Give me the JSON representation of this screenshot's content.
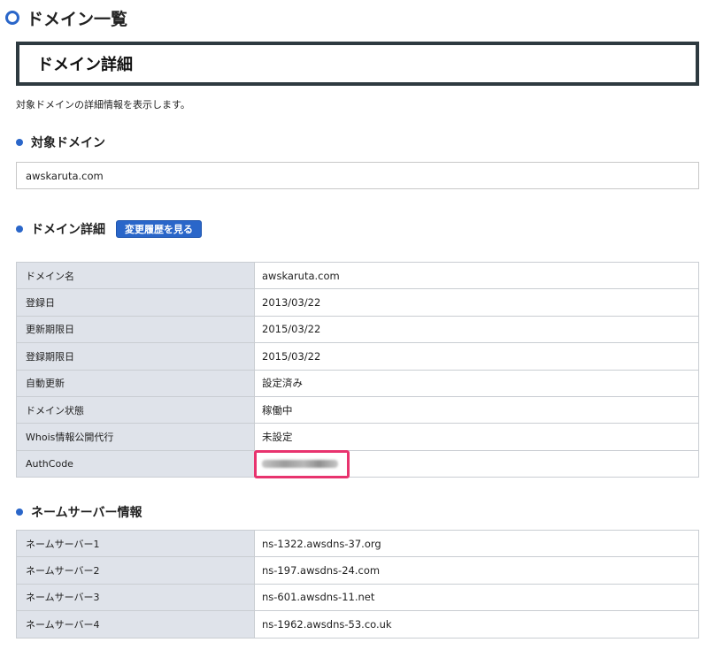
{
  "page_title": "ドメイン一覧",
  "header_box_title": "ドメイン詳細",
  "description": "対象ドメインの詳細情報を表示します。",
  "target_section": {
    "title": "対象ドメイン",
    "value": "awskaruta.com"
  },
  "detail_section": {
    "title": "ドメイン詳細",
    "history_button": "変更履歴を見る",
    "rows": [
      {
        "label": "ドメイン名",
        "value": "awskaruta.com"
      },
      {
        "label": "登録日",
        "value": "2013/03/22"
      },
      {
        "label": "更新期限日",
        "value": "2015/03/22"
      },
      {
        "label": "登録期限日",
        "value": "2015/03/22"
      },
      {
        "label": "自動更新",
        "value": "設定済み"
      },
      {
        "label": "ドメイン状態",
        "value": "稼働中"
      },
      {
        "label": "Whois情報公開代行",
        "value": "未設定"
      },
      {
        "label": "AuthCode",
        "value": ""
      }
    ]
  },
  "nameserver_section": {
    "title": "ネームサーバー情報",
    "rows": [
      {
        "label": "ネームサーバー1",
        "value": "ns-1322.awsdns-37.org"
      },
      {
        "label": "ネームサーバー2",
        "value": "ns-197.awsdns-24.com"
      },
      {
        "label": "ネームサーバー3",
        "value": "ns-601.awsdns-11.net"
      },
      {
        "label": "ネームサーバー4",
        "value": "ns-1962.awsdns-53.co.uk"
      }
    ]
  },
  "colors": {
    "accent": "#2a66c9",
    "header_border": "#2e3a40",
    "label_cell_bg": "#dfe3ea",
    "highlight": "#e8336e"
  }
}
